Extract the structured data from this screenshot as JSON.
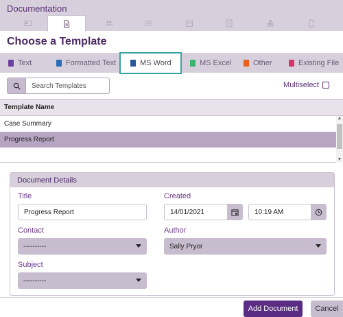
{
  "app_title": "Documentation",
  "top_tabs": [
    {
      "icon": "id-card-icon"
    },
    {
      "icon": "document-icon",
      "active": true
    },
    {
      "icon": "people-icon"
    },
    {
      "icon": "checklist-icon"
    },
    {
      "icon": "calendar-icon"
    },
    {
      "icon": "dollar-icon"
    },
    {
      "icon": "stamp-icon"
    },
    {
      "icon": "file-icon"
    }
  ],
  "heading": "Choose a Template",
  "template_types": [
    {
      "label": "Text",
      "icon": "text-file-icon",
      "color": "#6b3fa0"
    },
    {
      "label": "Formatted Text",
      "icon": "formatted-text-icon",
      "color": "#2a6fb5"
    },
    {
      "label": "MS Word",
      "icon": "word-icon",
      "color": "#2b579a",
      "active": true
    },
    {
      "label": "MS Excel",
      "icon": "excel-icon",
      "color": "#3cb371"
    },
    {
      "label": "Other",
      "icon": "question-icon",
      "color": "#e8601c"
    },
    {
      "label": "Existing File",
      "icon": "import-file-icon",
      "color": "#d6336c"
    }
  ],
  "search": {
    "placeholder": "Search Templates",
    "value": ""
  },
  "multiselect_label": "Multiselect",
  "table": {
    "header": "Template Name",
    "rows": [
      "Case Summary",
      "Progress Report"
    ],
    "selected_index": 1
  },
  "details": {
    "section_title": "Document Details",
    "title_label": "Title",
    "title_value": "Progress Report",
    "created_label": "Created",
    "created_date": "14/01/2021",
    "created_time": "10:19 AM",
    "contact_label": "Contact",
    "contact_value": "----------",
    "author_label": "Author",
    "author_value": "Sally Pryor",
    "subject_label": "Subject",
    "subject_value": "----------"
  },
  "buttons": {
    "add": "Add Document",
    "cancel": "Cancel"
  },
  "colors": {
    "brand": "#5a2d82",
    "accent_tab_border": "#3aa3a0",
    "selected_row": "#b7a5c4"
  }
}
